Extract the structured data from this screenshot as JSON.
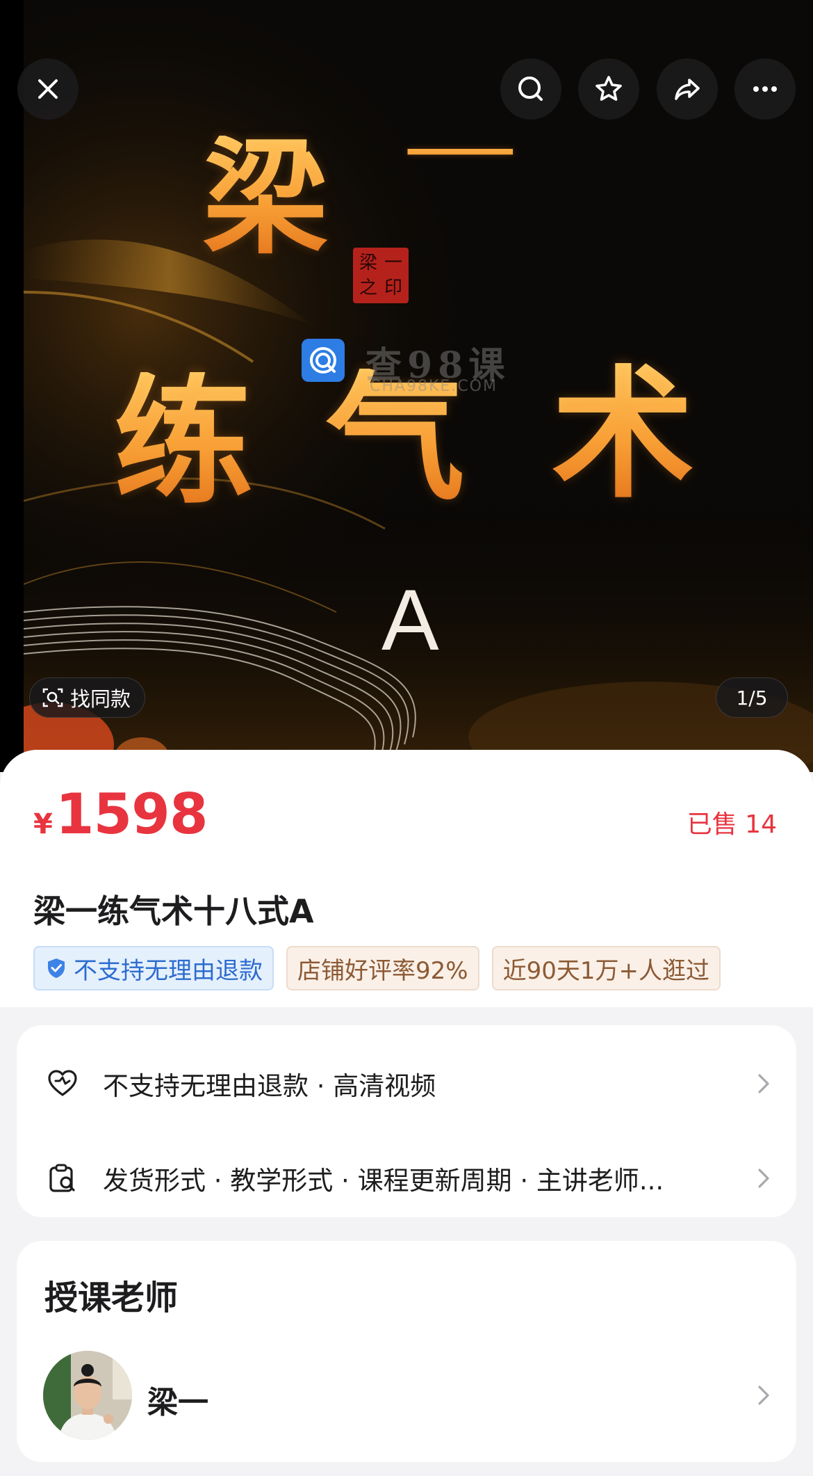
{
  "hero": {
    "title_chars": [
      "梁",
      "一",
      "练",
      "气",
      "术"
    ],
    "letter": "A",
    "seal_chars": [
      "梁",
      "一",
      "之",
      "印"
    ],
    "watermark": {
      "text": "查98课",
      "sub": "CHA98KE.COM"
    },
    "find_same_label": "找同款",
    "page_indicator": "1/5",
    "icons": [
      "close-icon",
      "search-icon",
      "star-icon",
      "share-icon",
      "more-icon"
    ]
  },
  "product": {
    "currency": "¥",
    "price": "1598",
    "sold": "已售 14",
    "title": "梁一练气术十八式A",
    "tags": [
      "不支持无理由退款",
      "店铺好评率92%",
      "近90天1万+人逛过"
    ]
  },
  "info": {
    "row1": "不支持无理由退款 · 高清视频",
    "row2": "发货形式 · 教学形式 · 课程更新周期 · 主讲老师..."
  },
  "teacher": {
    "heading": "授课老师",
    "name": "梁一"
  },
  "colors": {
    "price_red": "#e8343f",
    "tag_blue": "#2c6ccf",
    "tag_tan": "#8c5a35",
    "calligraphy_gold": "#f6a43a"
  }
}
